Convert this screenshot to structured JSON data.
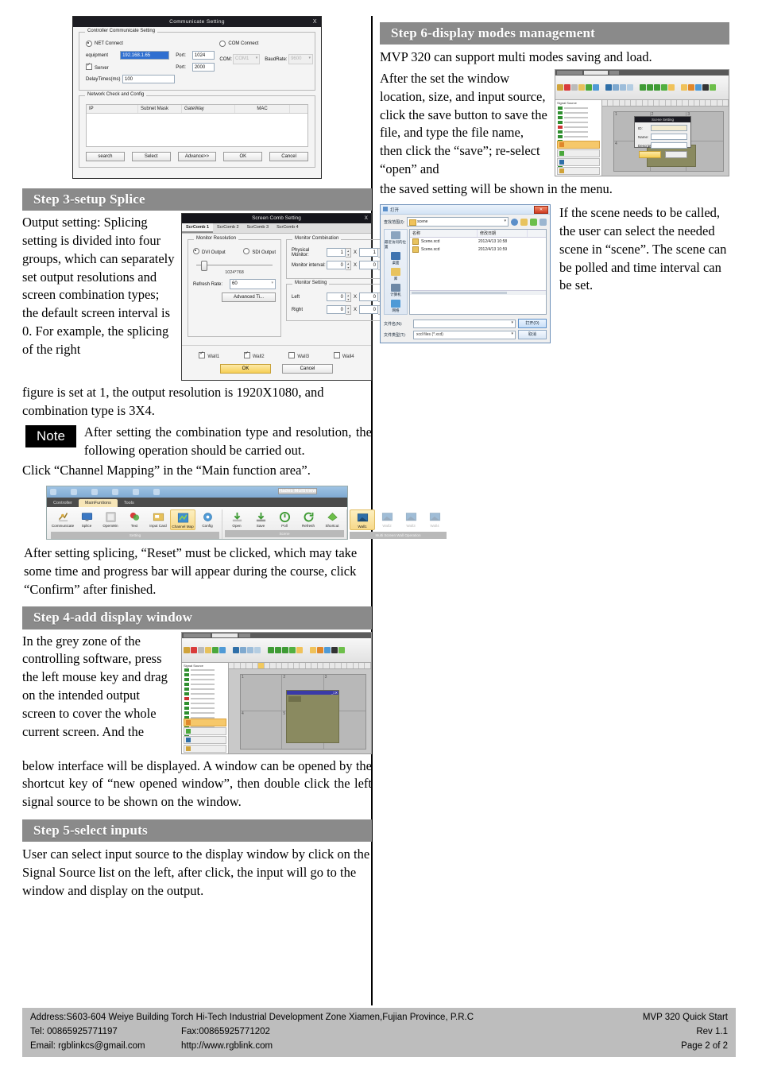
{
  "document": {
    "title": "MVP 320 Quick Start Guide page 2"
  },
  "comm_dialog": {
    "title": "Communicate Setting",
    "close": "X",
    "group_legend": "Controller Communicate Setting",
    "net_connect": "NET Connect",
    "com_connect": "COM Connect",
    "equipment_label": "equipment",
    "equipment_value": "192.168.1.65",
    "port_label_1": "Port:",
    "port_value_1": "1024",
    "server_label": "Server",
    "port_label_2": "Port:",
    "port_value_2": "2000",
    "delay_label": "DelayTimes(ms)",
    "delay_value": "100",
    "com_label": "COM:",
    "com_value": "COM1",
    "baudrate_label": "BaudRate:",
    "baudrate_value": "9600",
    "network_legend": "Network Check and Config",
    "table_headers": [
      "IP",
      "Subnet Mask",
      "GateWay",
      "MAC"
    ],
    "buttons": [
      "search",
      "Select",
      "Advance>>",
      "OK",
      "Cancel"
    ]
  },
  "step3": {
    "heading": "Step 3-setup Splice",
    "para_wrap": "Output setting: Splicing setting is divided into four groups, which can separately set output resolutions and screen combination types; the default screen interval is 0. For example, the splicing of the right",
    "para_full": "figure is set at 1, the output resolution is 1920X1080, and combination type is 3X4.",
    "note_badge": "Note",
    "note_text": "After setting the combination type and resolution, the following operation should be carried out.",
    "click_line": "Click “Channel Mapping” in the “Main function area”.",
    "after_text": "After setting splicing, “Reset” must be clicked, which may take some time and progress bar will appear during the course, click “Confirm” after finished."
  },
  "scomb_dialog": {
    "title": "Screen Comb Setting",
    "close": "X",
    "tabs": [
      "ScrComb 1",
      "ScrComb 2",
      "ScrComb 3",
      "ScrComb 4"
    ],
    "monitor_resolution_legend": "Monitor Resolution",
    "dvi_output": "DVI Output",
    "sdi_output": "SDI Output",
    "resolution_value": "1024*768",
    "refresh_label": "Refresh Rate:",
    "refresh_value": "60",
    "advanced_button": "Advanced Ti...",
    "monitor_combination_legend": "Monitor Combination",
    "physical_monitor_label": "Physical Monitor:",
    "physical_monitor_x": "1",
    "physical_monitor_y": "1",
    "monitor_interval_label": "Monitor interval:",
    "monitor_interval_x": "0",
    "monitor_interval_y": "0",
    "monitor_setting_legend": "Monitor Setting",
    "left_label": "Left",
    "left_x": "0",
    "left_y": "0",
    "right_label": "Right",
    "right_x": "0",
    "right_y": "0",
    "multiplier": "X",
    "walls": [
      "Wall1",
      "Wall2",
      "Wall3",
      "Wall4"
    ],
    "ok": "OK",
    "cancel": "Cancel"
  },
  "ribbon": {
    "app_title": "Hades MultiView",
    "tabs": [
      "Controller",
      "MainFuntions",
      "Tools"
    ],
    "groups": [
      {
        "caption": "Setting",
        "items": [
          {
            "label": "Communicate",
            "highlight": false
          },
          {
            "label": "Splice",
            "highlight": false
          },
          {
            "label": "OpenWin",
            "highlight": false
          },
          {
            "label": "Text",
            "highlight": false
          },
          {
            "label": "Input Card",
            "highlight": false
          },
          {
            "label": "Channel Map",
            "highlight": true
          },
          {
            "label": "Config",
            "highlight": false
          }
        ]
      },
      {
        "caption": "Scene",
        "items": [
          {
            "label": "Open",
            "highlight": false
          },
          {
            "label": "Save",
            "highlight": false
          },
          {
            "label": "Poll",
            "highlight": false
          },
          {
            "label": "Refresh",
            "highlight": false
          },
          {
            "label": "Shortcut",
            "highlight": false
          }
        ]
      },
      {
        "caption": "Multi Screen Wall Operation",
        "items": [
          {
            "label": "Wall1",
            "highlight": true
          },
          {
            "label": "Wall2",
            "highlight": false,
            "dim": true
          },
          {
            "label": "Wall3",
            "highlight": false,
            "dim": true
          },
          {
            "label": "Wall4",
            "highlight": false,
            "dim": true
          }
        ]
      }
    ]
  },
  "step4": {
    "heading": "Step 4-add display window",
    "para_wrap": "In the grey zone of the controlling software, press the left mouse key and drag on the intended output screen to cover the whole current screen. And the",
    "para_full": "below interface will be displayed. A window can be opened by the shortcut key of “new opened window”, then double click the left signal source to be shown on the window."
  },
  "step5": {
    "heading": "Step 5-select inputs",
    "para": "User can select input source to the display window by click on the Signal Source list on the left, after click, the input will go to the window and display on the output."
  },
  "step6": {
    "heading": "Step 6-display modes management",
    "intro": "MVP 320 can support multi modes saving and load.",
    "para_wrap": "After the set the window location, size, and input source, click the save button to save the file, and type the file name, then click the “save”; re-select “open” and",
    "para_full": "the saved setting will be shown in the menu.",
    "para_scene": "If the scene needs to be called, the user can select the needed scene in “scene”. The scene can be polled and time interval can be set."
  },
  "app_screens": {
    "signal_source_label": "Signal Source",
    "screen_cells": [
      "1",
      "2",
      "3",
      "4",
      "5",
      "6"
    ],
    "scene_dialog": {
      "title": "Scene Setting",
      "fields": [
        "ID:",
        "Name:",
        "Description:"
      ],
      "id_value": "1",
      "ok": "OK",
      "cancel": "Cancel"
    }
  },
  "file_dialog": {
    "title": "打开",
    "close": "✕",
    "lookin_label": "查找范围(I):",
    "lookin_value": "scene",
    "col_name": "名称",
    "col_date": "修改日期",
    "places": [
      "最近访问的位置",
      "桌面",
      "库",
      "计算机",
      "网络"
    ],
    "files": [
      {
        "name": "Scene.xcd",
        "date": "2012/4/13 10:58"
      },
      {
        "name": "Scene.xcd",
        "date": "2012/4/13 10:59"
      }
    ],
    "filename_label": "文件名(N):",
    "filename_value": "",
    "filetype_label": "文件类型(T):",
    "filetype_value": "xcd files (*.xcd)",
    "open_button": "打开(O)",
    "cancel_button": "取消"
  },
  "footer": {
    "address": "Address:S603-604 Weiye Building Torch Hi-Tech Industrial Development Zone Xiamen,Fujian Province, P.R.C",
    "tel": "Tel: 00865925771197",
    "fax": "Fax:00865925771202",
    "email": "Email: rgblinkcs@gmail.com",
    "web": "http://www.rgblink.com",
    "doc_title": "MVP 320 Quick Start",
    "rev": "Rev 1.1",
    "page": "Page 2 of 2"
  },
  "colors": {
    "step_bar": "#8a8a8a",
    "footer_bar": "#bdbdbd",
    "highlight": "#f7d98a",
    "window_fill": "#8a8a60"
  }
}
